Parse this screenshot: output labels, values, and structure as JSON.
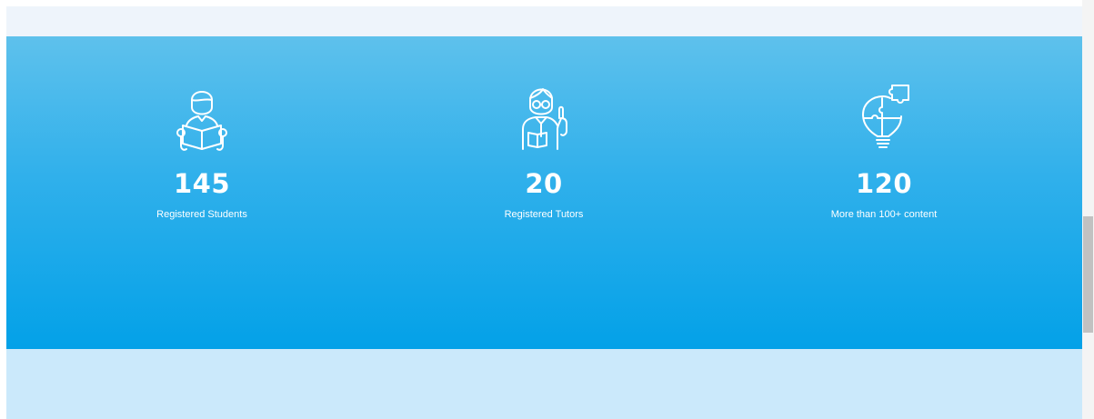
{
  "stats": [
    {
      "icon": "student-reading-icon",
      "value": "145",
      "label": "Registered Students"
    },
    {
      "icon": "tutor-icon",
      "value": "20",
      "label": "Registered Tutors"
    },
    {
      "icon": "lightbulb-puzzle-icon",
      "value": "120",
      "label": "More than 100+ content"
    }
  ],
  "colors": {
    "band_top": "#5ec1ec",
    "band_bottom": "#03a1e8",
    "header_strip": "#eef4fb",
    "footer_strip": "#cbe9fb",
    "text": "#ffffff"
  }
}
